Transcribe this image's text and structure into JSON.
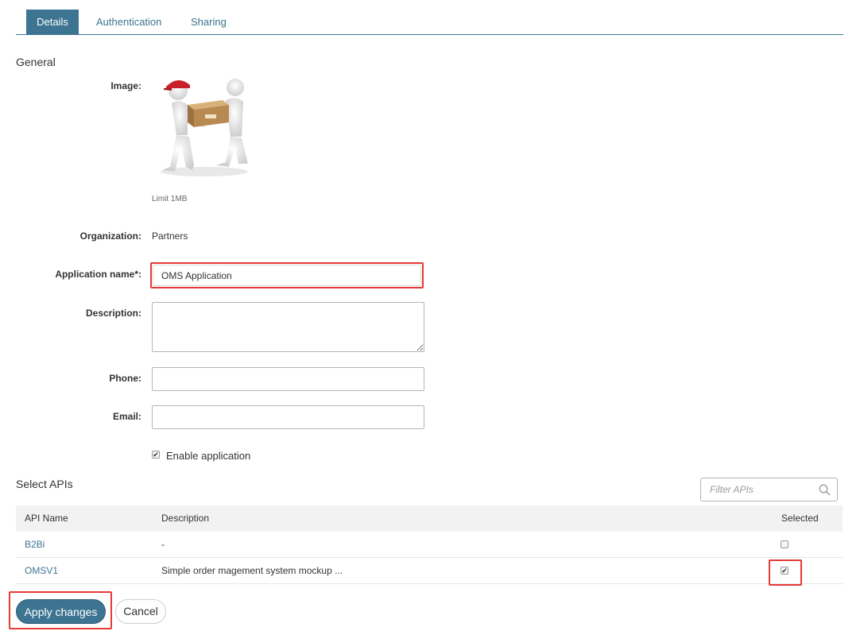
{
  "tabs": [
    {
      "label": "Details",
      "active": true
    },
    {
      "label": "Authentication",
      "active": false
    },
    {
      "label": "Sharing",
      "active": false
    }
  ],
  "general": {
    "section_title": "General",
    "image_label": "Image:",
    "image_hint": "Limit 1MB",
    "organization_label": "Organization:",
    "organization_value": "Partners",
    "app_name_label": "Application name*:",
    "app_name_value": "OMS Application",
    "description_label": "Description:",
    "description_value": "",
    "phone_label": "Phone:",
    "phone_value": "",
    "email_label": "Email:",
    "email_value": "",
    "enable_label": "Enable application",
    "enable_checked": true
  },
  "apis": {
    "section_title": "Select APIs",
    "filter_placeholder": "Filter APIs",
    "columns": [
      "API Name",
      "Description",
      "Selected"
    ],
    "rows": [
      {
        "name": "B2Bi",
        "description": "-",
        "selected": false
      },
      {
        "name": "OMSV1",
        "description": "Simple order magement system mockup ...",
        "selected": true
      }
    ]
  },
  "actions": {
    "apply_label": "Apply changes",
    "cancel_label": "Cancel"
  },
  "colors": {
    "accent": "#3c7491",
    "highlight": "#e53935"
  }
}
